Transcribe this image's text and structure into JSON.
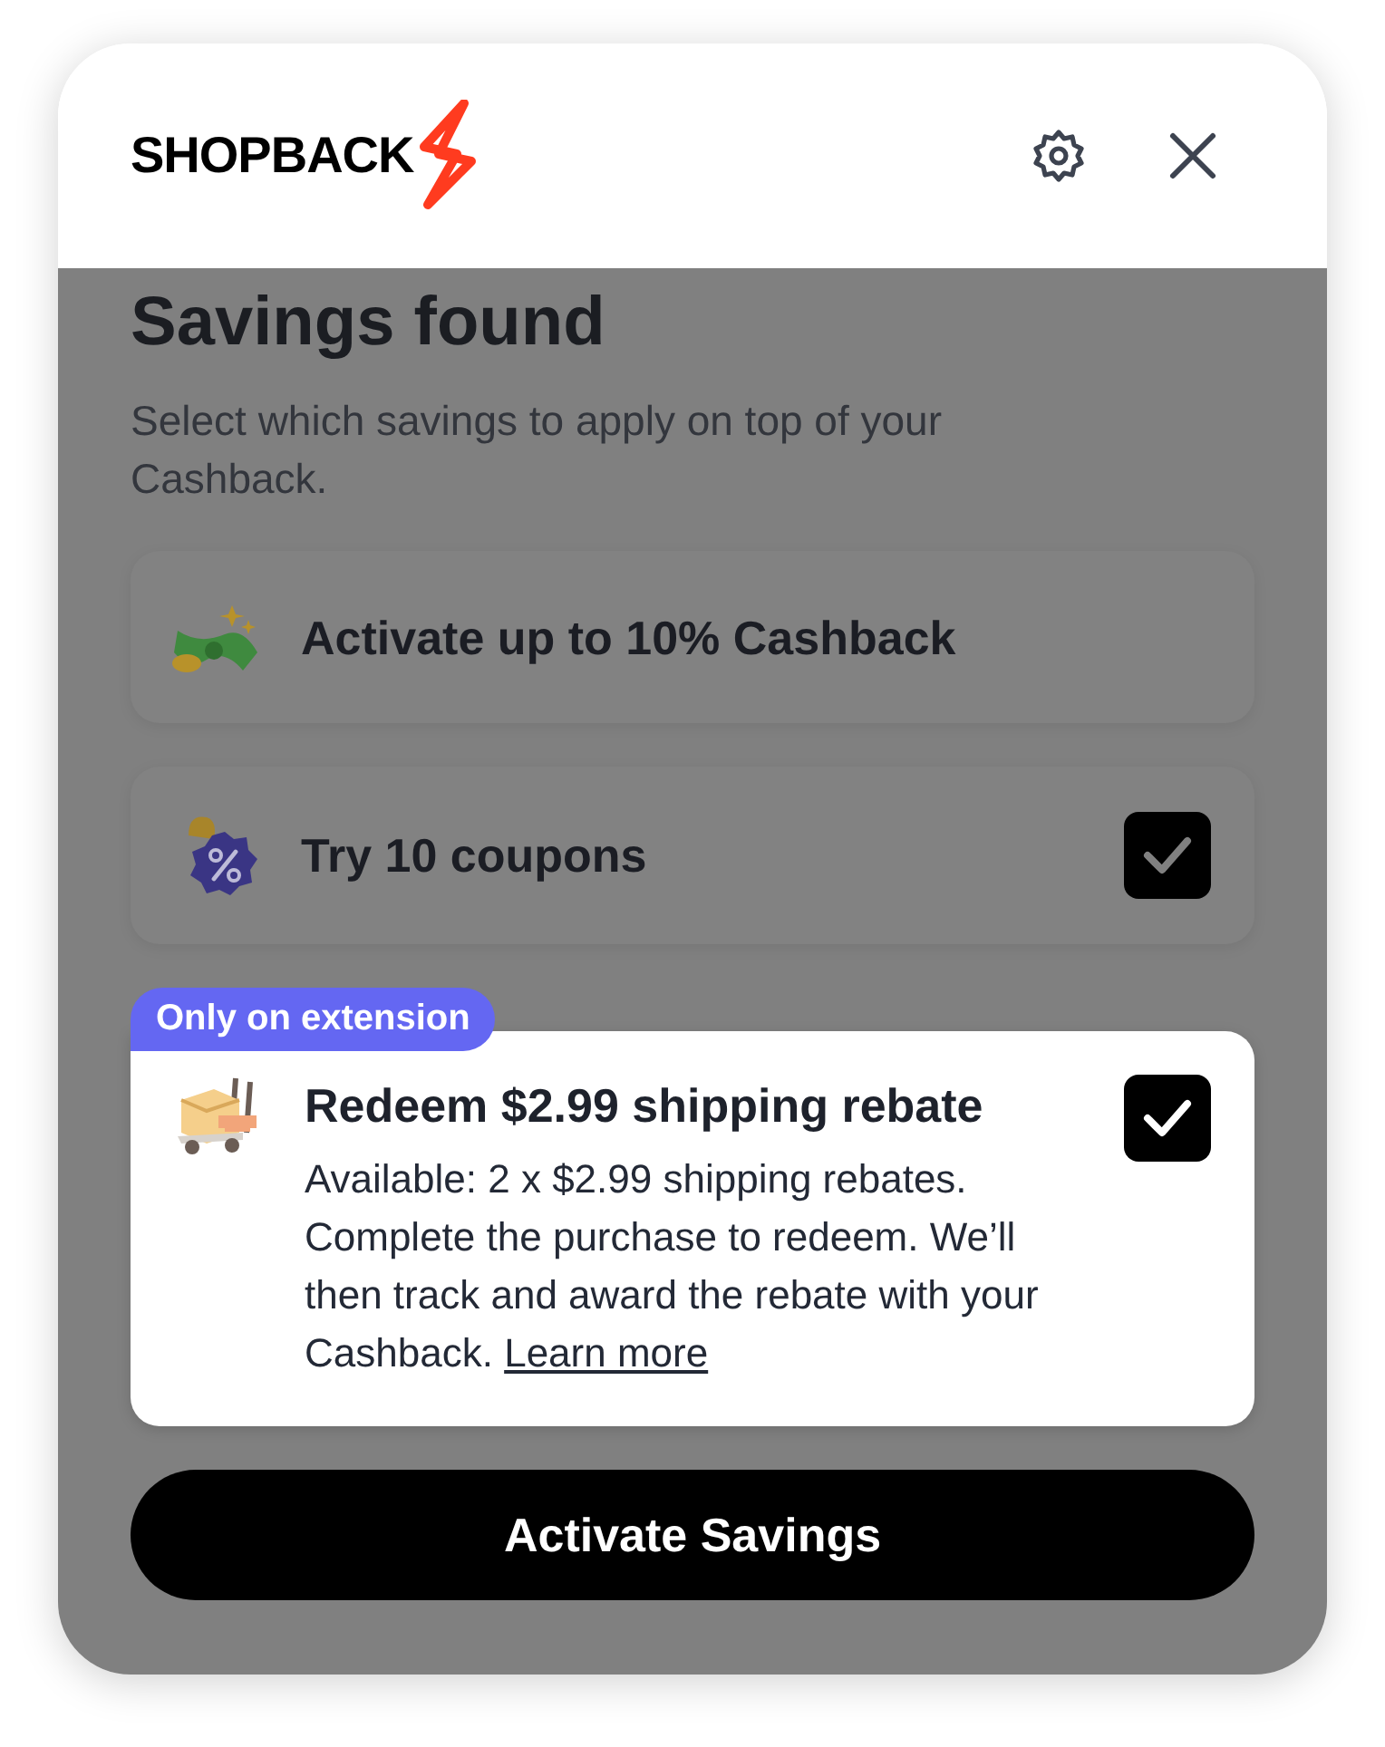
{
  "header": {
    "logo": "SHOPBACK"
  },
  "title": "Savings found",
  "subtitle": "Select which savings to apply on top of your Cashback.",
  "offers": [
    {
      "kind": "cashback",
      "title": "Activate up to 10% Cashback",
      "highlighted": false
    },
    {
      "kind": "coupons",
      "title": "Try 10 coupons",
      "checked": true,
      "highlighted": false
    },
    {
      "kind": "shipping",
      "badge": "Only on extension",
      "title": "Redeem $2.99 shipping rebate",
      "description": "Available: 2 x $2.99 shipping rebates. Complete the purchase to redeem. We’ll then track and award the rebate with your Cashback.",
      "link": "Learn more",
      "checked": true,
      "highlighted": true
    }
  ],
  "button": "Activate Savings"
}
